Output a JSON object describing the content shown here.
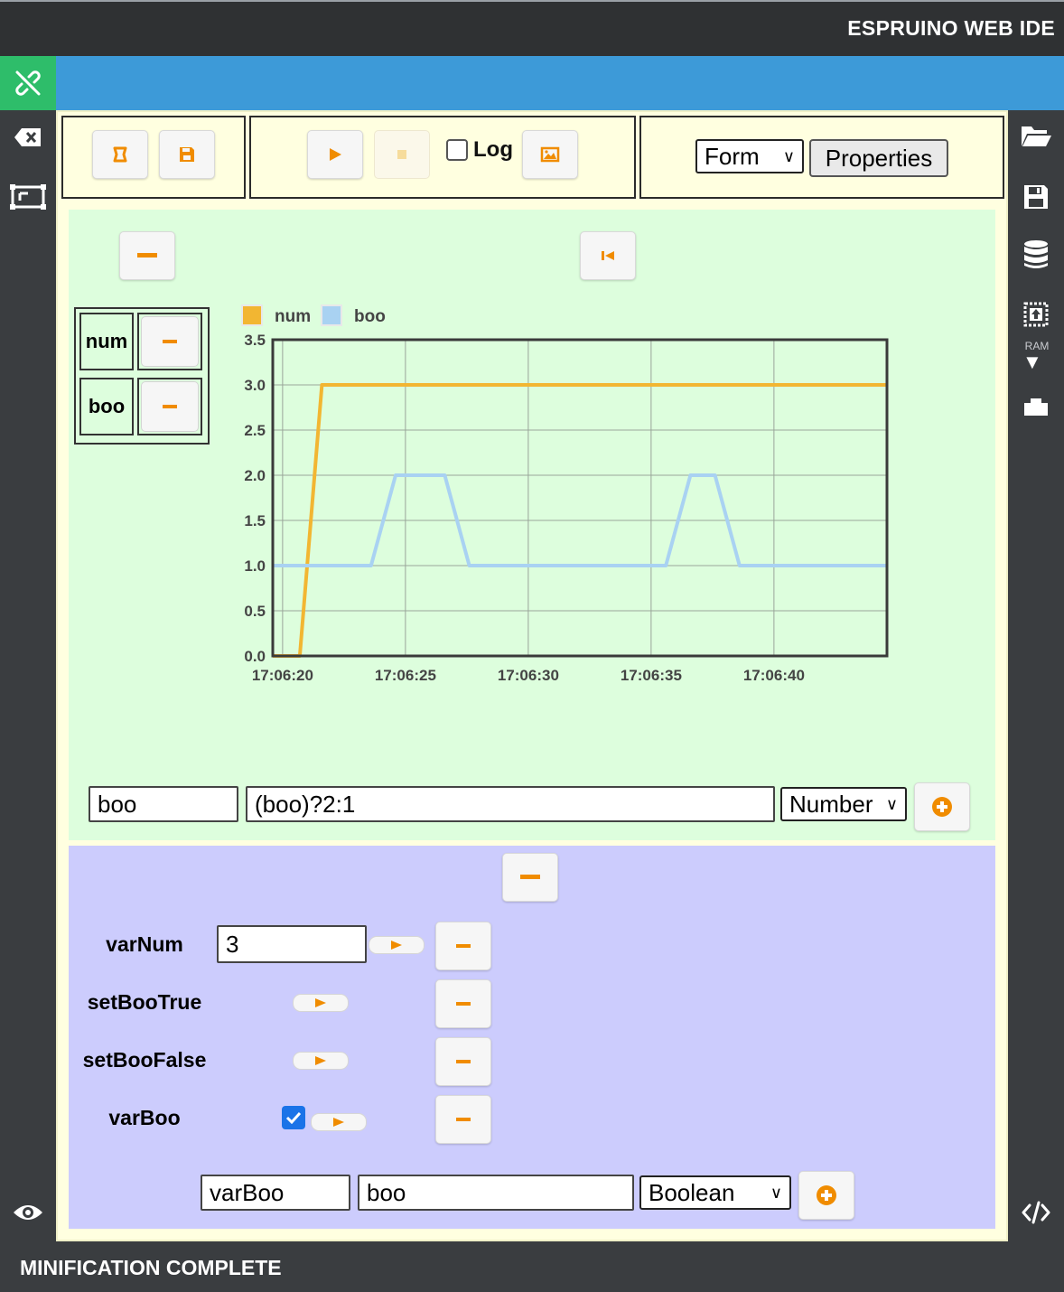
{
  "app": {
    "title": "ESPRUINO WEB IDE"
  },
  "status": {
    "message": "MINIFICATION COMPLETE"
  },
  "colors": {
    "connected": "#2ebd6a",
    "toolbar_blue": "#3d9ad8",
    "accent": "#f08c00",
    "chart_panel": "#ddfedd",
    "vars_panel": "#ccccfd",
    "num_series": "#f2b632",
    "boo_series": "#a9d2f2"
  },
  "sidebar": {
    "left_icons": [
      "plug-icon",
      "clear-console-icon",
      "terminal-frame-icon",
      "eye-icon"
    ],
    "right_icons": [
      "folder-open-icon",
      "save-icon",
      "storage-icon",
      "send-to-ram-icon",
      "sd-card-icon",
      "code-icon"
    ],
    "ram_label": "RAM",
    "ram_arrow": "▼"
  },
  "toolbar": {
    "log_label": "Log",
    "log_checked": false,
    "form_select": "Form",
    "properties_label": "Properties"
  },
  "chart_data": {
    "type": "line",
    "legend": [
      {
        "name": "num",
        "color": "#f2b632"
      },
      {
        "name": "boo",
        "color": "#a9d2f2"
      }
    ],
    "legend_position": "top-left",
    "grid": true,
    "ylim": [
      0,
      3.5
    ],
    "yticks": [
      "0.0",
      "0.5",
      "1.0",
      "1.5",
      "2.0",
      "2.5",
      "3.0",
      "3.5"
    ],
    "xlim": [
      "17:06:19.6",
      "17:06:44.6"
    ],
    "xticks": [
      "17:06:20",
      "17:06:25",
      "17:06:30",
      "17:06:35",
      "17:06:40"
    ],
    "series": [
      {
        "name": "num",
        "color": "#f2b632",
        "x": [
          "17:06:19.6",
          "17:06:20.7",
          "17:06:21.6",
          "17:06:44.6"
        ],
        "y": [
          0,
          0,
          3,
          3
        ]
      },
      {
        "name": "boo",
        "color": "#a9d2f2",
        "x": [
          "17:06:19.6",
          "17:06:23.6",
          "17:06:24.6",
          "17:06:26.6",
          "17:06:27.6",
          "17:06:35.6",
          "17:06:36.6",
          "17:06:37.6",
          "17:06:38.6",
          "17:06:44.6"
        ],
        "y": [
          1,
          1,
          2,
          2,
          1,
          1,
          2,
          2,
          1,
          1
        ]
      }
    ]
  },
  "chart_vars": [
    {
      "name": "num"
    },
    {
      "name": "boo"
    }
  ],
  "chart_input": {
    "name": "boo",
    "expression": "(boo)?2:1",
    "type": "Number"
  },
  "vars": [
    {
      "label": "varNum",
      "kind": "value",
      "value": "3"
    },
    {
      "label": "setBooTrue",
      "kind": "call"
    },
    {
      "label": "setBooFalse",
      "kind": "call"
    },
    {
      "label": "varBoo",
      "kind": "checkbox",
      "checked": true
    }
  ],
  "var_input": {
    "name": "varBoo",
    "expression": "boo",
    "type": "Boolean"
  }
}
